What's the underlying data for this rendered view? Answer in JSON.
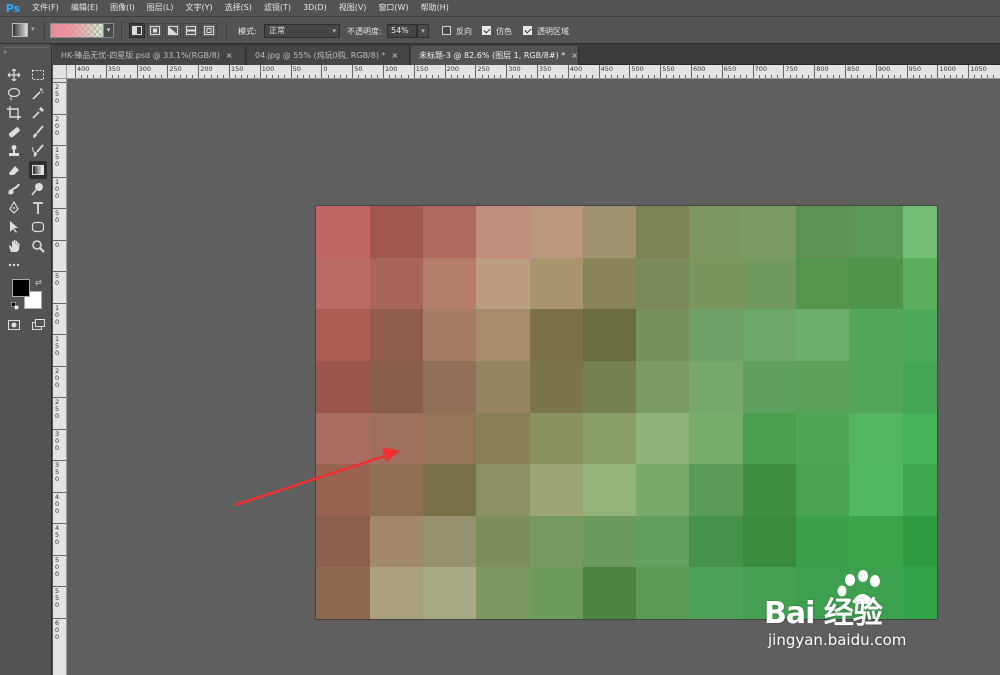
{
  "app": {
    "logo": "Ps"
  },
  "menu": [
    "文件(F)",
    "编辑(E)",
    "图像(I)",
    "图层(L)",
    "文字(Y)",
    "选择(S)",
    "滤镜(T)",
    "3D(D)",
    "视图(V)",
    "窗口(W)",
    "帮助(H)"
  ],
  "options": {
    "mode_label": "模式:",
    "mode_value": "正常",
    "opacity_label": "不透明度:",
    "opacity_value": "54%",
    "reverse_label": "反向",
    "reverse_checked": false,
    "dither_label": "仿色",
    "dither_checked": true,
    "transparency_label": "透明区域",
    "transparency_checked": true
  },
  "tabs": [
    {
      "label": "HK-臻品无忧-四星版.psd @ 33.1%(RGB/8)",
      "close": "×",
      "active": false
    },
    {
      "label": "04.jpg @ 55% (炖玩0购, RGB/8) *",
      "close": "×",
      "active": false
    },
    {
      "label": "未标题-3 @ 82.6% (图层 1, RGB/8#) *",
      "close": "×",
      "active": true
    }
  ],
  "ruler_h_labels": [
    "400",
    "350",
    "300",
    "250",
    "200",
    "150",
    "100",
    "50",
    "0",
    "50",
    "100",
    "150",
    "200",
    "250",
    "300",
    "350",
    "400",
    "450",
    "500",
    "550",
    "600",
    "650",
    "700",
    "750",
    "800",
    "850",
    "900",
    "950",
    "1000",
    "1050"
  ],
  "ruler_v_labels": [
    "2\n5\n0",
    "2\n0\n0",
    "1\n5\n0",
    "1\n0\n0",
    "5\n0",
    "0",
    "5\n0",
    "1\n0\n0",
    "1\n5\n0",
    "2\n0\n0",
    "2\n5\n0",
    "3\n0\n0",
    "3\n5\n0",
    "4\n0\n0",
    "4\n5\n0",
    "5\n0\n0",
    "5\n5\n0",
    "6\n0\n0"
  ],
  "mosaic": {
    "cols": 12,
    "rows": 8,
    "colors": [
      [
        "#c26566",
        "#a15750",
        "#b06a62",
        "#c38e80",
        "#bb9680",
        "#a09270",
        "#7c8254",
        "#7c9860",
        "#7a9c62",
        "#5c9352",
        "#5a9a56",
        "#72bf74"
      ],
      [
        "#bb6b67",
        "#a9645d",
        "#b67c6e",
        "#bb9c84",
        "#a9946e",
        "#8a8558",
        "#7b8a5a",
        "#7b965c",
        "#729a5e",
        "#54954c",
        "#4e974a",
        "#5cae5c"
      ],
      [
        "#ad5d56",
        "#915c4f",
        "#a77c68",
        "#a58c6c",
        "#7c7048",
        "#6a6b3e",
        "#78915c",
        "#6fa06a",
        "#6ca668",
        "#6ab06c",
        "#52a75a",
        "#4caa58"
      ],
      [
        "#9b554c",
        "#895e4c",
        "#90705a",
        "#968463",
        "#7b754c",
        "#75814e",
        "#7a9c62",
        "#75a86a",
        "#5ea05e",
        "#5aa25a",
        "#53a557",
        "#44a552"
      ],
      [
        "#ab6d63",
        "#9e6e5e",
        "#937659",
        "#8a8058",
        "#8b905f",
        "#8a9f66",
        "#8db378",
        "#76ad6a",
        "#4c9e4f",
        "#4ea753",
        "#53b65f",
        "#47b359"
      ],
      [
        "#9a6351",
        "#8f6f55",
        "#787048",
        "#8c9064",
        "#9ba472",
        "#93b578",
        "#7aaa69",
        "#5a9c57",
        "#3f8e3f",
        "#48a54e",
        "#52b761",
        "#3fa750"
      ],
      [
        "#8e5e4e",
        "#a1886c",
        "#969271",
        "#7c8e5a",
        "#75995e",
        "#6b9a5c",
        "#61a05e",
        "#47924a",
        "#3a8c3c",
        "#3ca04a",
        "#39a547",
        "#2e9c3f"
      ],
      [
        "#8e6a50",
        "#aaa080",
        "#a7a986",
        "#7c9760",
        "#6e9a5c",
        "#4b8440",
        "#5a9c56",
        "#4da35a",
        "#43a151",
        "#3da04e",
        "#3ca04e",
        "#34a44a"
      ]
    ]
  },
  "watermark": {
    "brand": "Bai  经验",
    "url": "jingyan.baidu.com"
  }
}
